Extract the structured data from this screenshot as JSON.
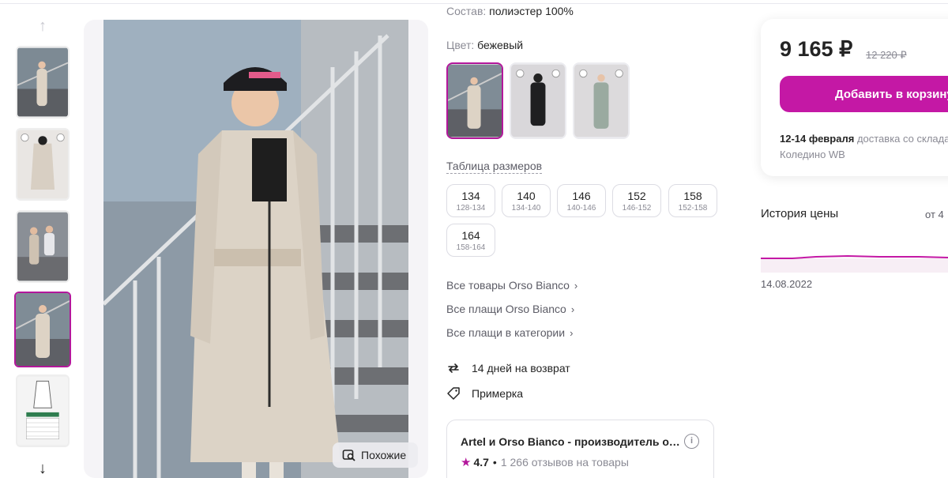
{
  "product": {
    "composition_label": "Состав:",
    "composition_value": "полиэстер 100%",
    "color_label": "Цвет:",
    "color_value": "бежевый",
    "size_table_link": "Таблица размеров",
    "sizes": [
      {
        "main": "134",
        "sub": "128-134"
      },
      {
        "main": "140",
        "sub": "134-140"
      },
      {
        "main": "146",
        "sub": "140-146"
      },
      {
        "main": "152",
        "sub": "146-152"
      },
      {
        "main": "158",
        "sub": "152-158"
      },
      {
        "main": "164",
        "sub": "158-164"
      }
    ],
    "links": [
      "Все товары Orso Bianco",
      "Все плащи Orso Bianco",
      "Все плащи в категории"
    ],
    "features": {
      "return": "14 дней на возврат",
      "fitting": "Примерка"
    }
  },
  "gallery": {
    "similar_button": "Похожие"
  },
  "seller": {
    "name": "Artel и Orso Bianco - производитель оде...",
    "info_icon": "i",
    "star": "★",
    "rating": "4.7",
    "separator": "•",
    "reviews": "1 266 отзывов на товары"
  },
  "price": {
    "current": "9 165 ₽",
    "old": "12 220 ₽",
    "add_button": "Добавить в корзину",
    "delivery_date": "12-14 февраля",
    "delivery_text": "доставка со склада",
    "warehouse": "Коледино WB"
  },
  "history": {
    "title": "История цены",
    "from": "от 4",
    "date": "14.08.2022"
  },
  "colors": {
    "accent": "#c418a5",
    "active_border": "#b3179b",
    "muted": "#8b8b95"
  }
}
